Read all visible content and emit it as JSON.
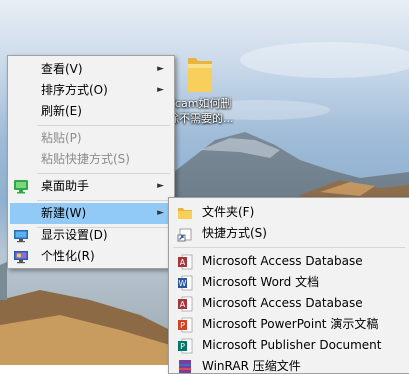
{
  "desktop": {
    "icon_caption_line1": "ifcam如何删",
    "icon_caption_line2": "除不需要的..."
  },
  "context_menu": {
    "items": [
      {
        "label": "查看(V)",
        "has_submenu": true,
        "enabled": true
      },
      {
        "label": "排序方式(O)",
        "has_submenu": true,
        "enabled": true
      },
      {
        "label": "刷新(E)",
        "has_submenu": false,
        "enabled": true
      },
      {
        "label": "粘贴(P)",
        "has_submenu": false,
        "enabled": false
      },
      {
        "label": "粘贴快捷方式(S)",
        "has_submenu": false,
        "enabled": false
      },
      {
        "label": "桌面助手",
        "has_submenu": true,
        "enabled": true,
        "icon": "desktop-assistant-icon"
      },
      {
        "label": "新建(W)",
        "has_submenu": true,
        "enabled": true,
        "highlighted": true
      },
      {
        "label": "显示设置(D)",
        "has_submenu": false,
        "enabled": true,
        "icon": "display-settings-icon"
      },
      {
        "label": "个性化(R)",
        "has_submenu": false,
        "enabled": true,
        "icon": "personalize-icon"
      }
    ]
  },
  "new_submenu": {
    "items": [
      {
        "label": "文件夹(F)",
        "icon": "folder-icon"
      },
      {
        "label": "快捷方式(S)",
        "icon": "shortcut-icon"
      },
      {
        "label": "Microsoft Access Database",
        "icon": "access-icon"
      },
      {
        "label": "Microsoft Word 文档",
        "icon": "word-icon"
      },
      {
        "label": "Microsoft Access Database",
        "icon": "access-icon"
      },
      {
        "label": "Microsoft PowerPoint 演示文稿",
        "icon": "powerpoint-icon"
      },
      {
        "label": "Microsoft Publisher Document",
        "icon": "publisher-icon"
      },
      {
        "label": "WinRAR 压缩文件",
        "icon": "winrar-icon"
      }
    ]
  },
  "colors": {
    "menu_bg": "#f2f2f2",
    "highlight": "#91c9f7",
    "disabled_text": "#8c8c8c"
  }
}
